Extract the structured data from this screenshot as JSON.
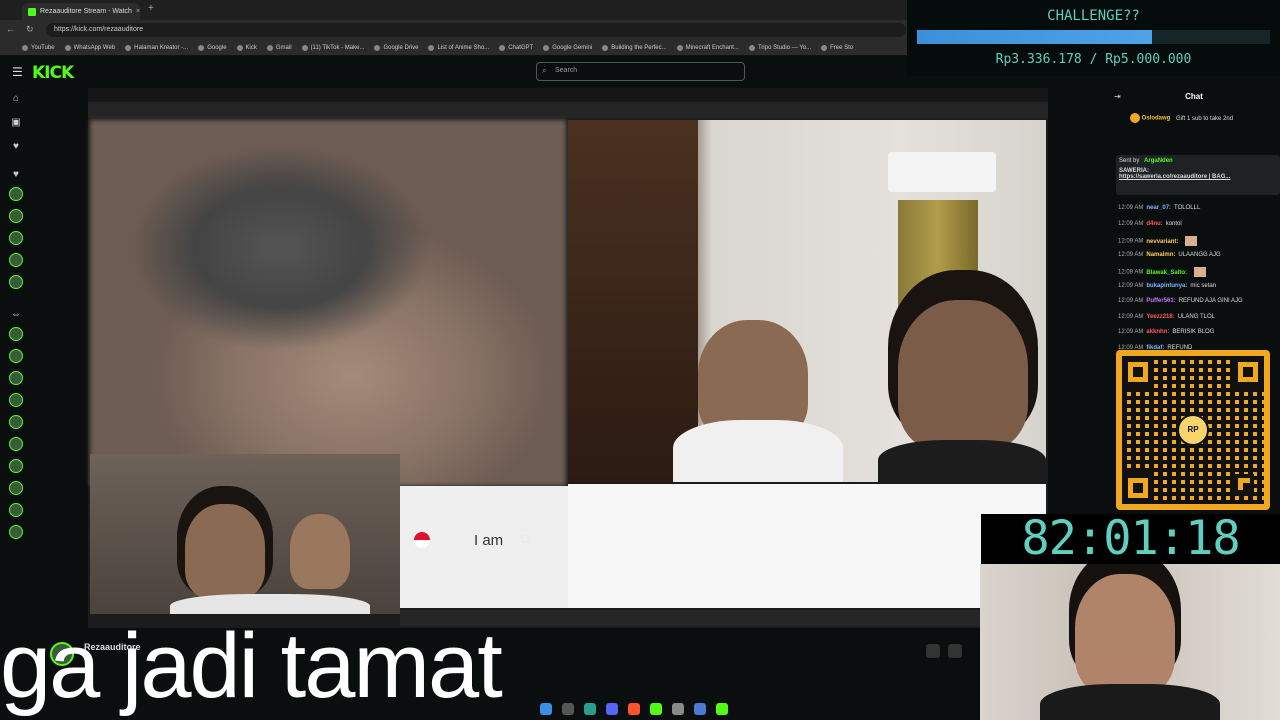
{
  "browser": {
    "tab_title": "Rezaauditore Stream - Watch",
    "url": "https://kick.com/rezaauditore",
    "bookmarks": [
      "YouTube",
      "WhatsApp Web",
      "Halaman Kreator -...",
      "Google",
      "Kick",
      "Gmail",
      "(11) TikTok - Make...",
      "Google Drive",
      "List of Anime Sho...",
      "ChatGPT",
      "Google Gemini",
      "Building the Perfec...",
      "Minecraft Enchant...",
      "Tripo Studio — Yo...",
      "Free Sto"
    ]
  },
  "kick": {
    "logo": "KICK",
    "search_placeholder": "Search"
  },
  "stream": {
    "card_text": "I am"
  },
  "chat": {
    "title": "Chat",
    "pinned_user": "Oslodawg",
    "pinned_text": "Gift 1 sub to take 2nd",
    "sawer_sender": "Sent by",
    "sawer_user": "ArgaNden",
    "sawer_label": "SAWERIA:",
    "sawer_link": "https://saweria.co/rezaauditore | BAG...",
    "messages": [
      {
        "time": "12:09 AM",
        "user": "near_07:",
        "text": "TOLOLLL",
        "color": "#7fb6ff"
      },
      {
        "time": "12:09 AM",
        "user": "d4nu:",
        "text": "kontol",
        "color": "#ff5a5a"
      },
      {
        "time": "12:09 AM",
        "user": "nevvariant:",
        "text": "",
        "color": "#ffcf5a"
      },
      {
        "time": "12:09 AM",
        "user": "Namaimn:",
        "text": "ULAANGG AJG",
        "color": "#ffcf5a"
      },
      {
        "time": "12:09 AM",
        "user": "Blawak_Salto:",
        "text": "",
        "color": "#53fc18"
      },
      {
        "time": "12:09 AM",
        "user": "bukapintunya:",
        "text": "mic setan",
        "color": "#7fb6ff"
      },
      {
        "time": "12:09 AM",
        "user": "Puffer561:",
        "text": "REFUND AJA GINI AJG",
        "color": "#c07bff"
      },
      {
        "time": "12:09 AM",
        "user": "Yeezz218:",
        "text": "ULANG TLOL",
        "color": "#ff5a5a"
      },
      {
        "time": "12:09 AM",
        "user": "akknhn:",
        "text": "BERISIK BLOG",
        "color": "#ff5a5a"
      },
      {
        "time": "12:09 AM",
        "user": "fikdaf:",
        "text": "REFUND",
        "color": "#7fb6ff"
      }
    ]
  },
  "qr": {
    "logo_text": "RP"
  },
  "challenge": {
    "title": "CHALLENGE??",
    "amount": "Rp3.336.178 / Rp5.000.000",
    "progress": 0.667
  },
  "timer": "82:01:18",
  "channel": {
    "name": "Rezaauditore"
  },
  "caption": "ga jadi tamat"
}
